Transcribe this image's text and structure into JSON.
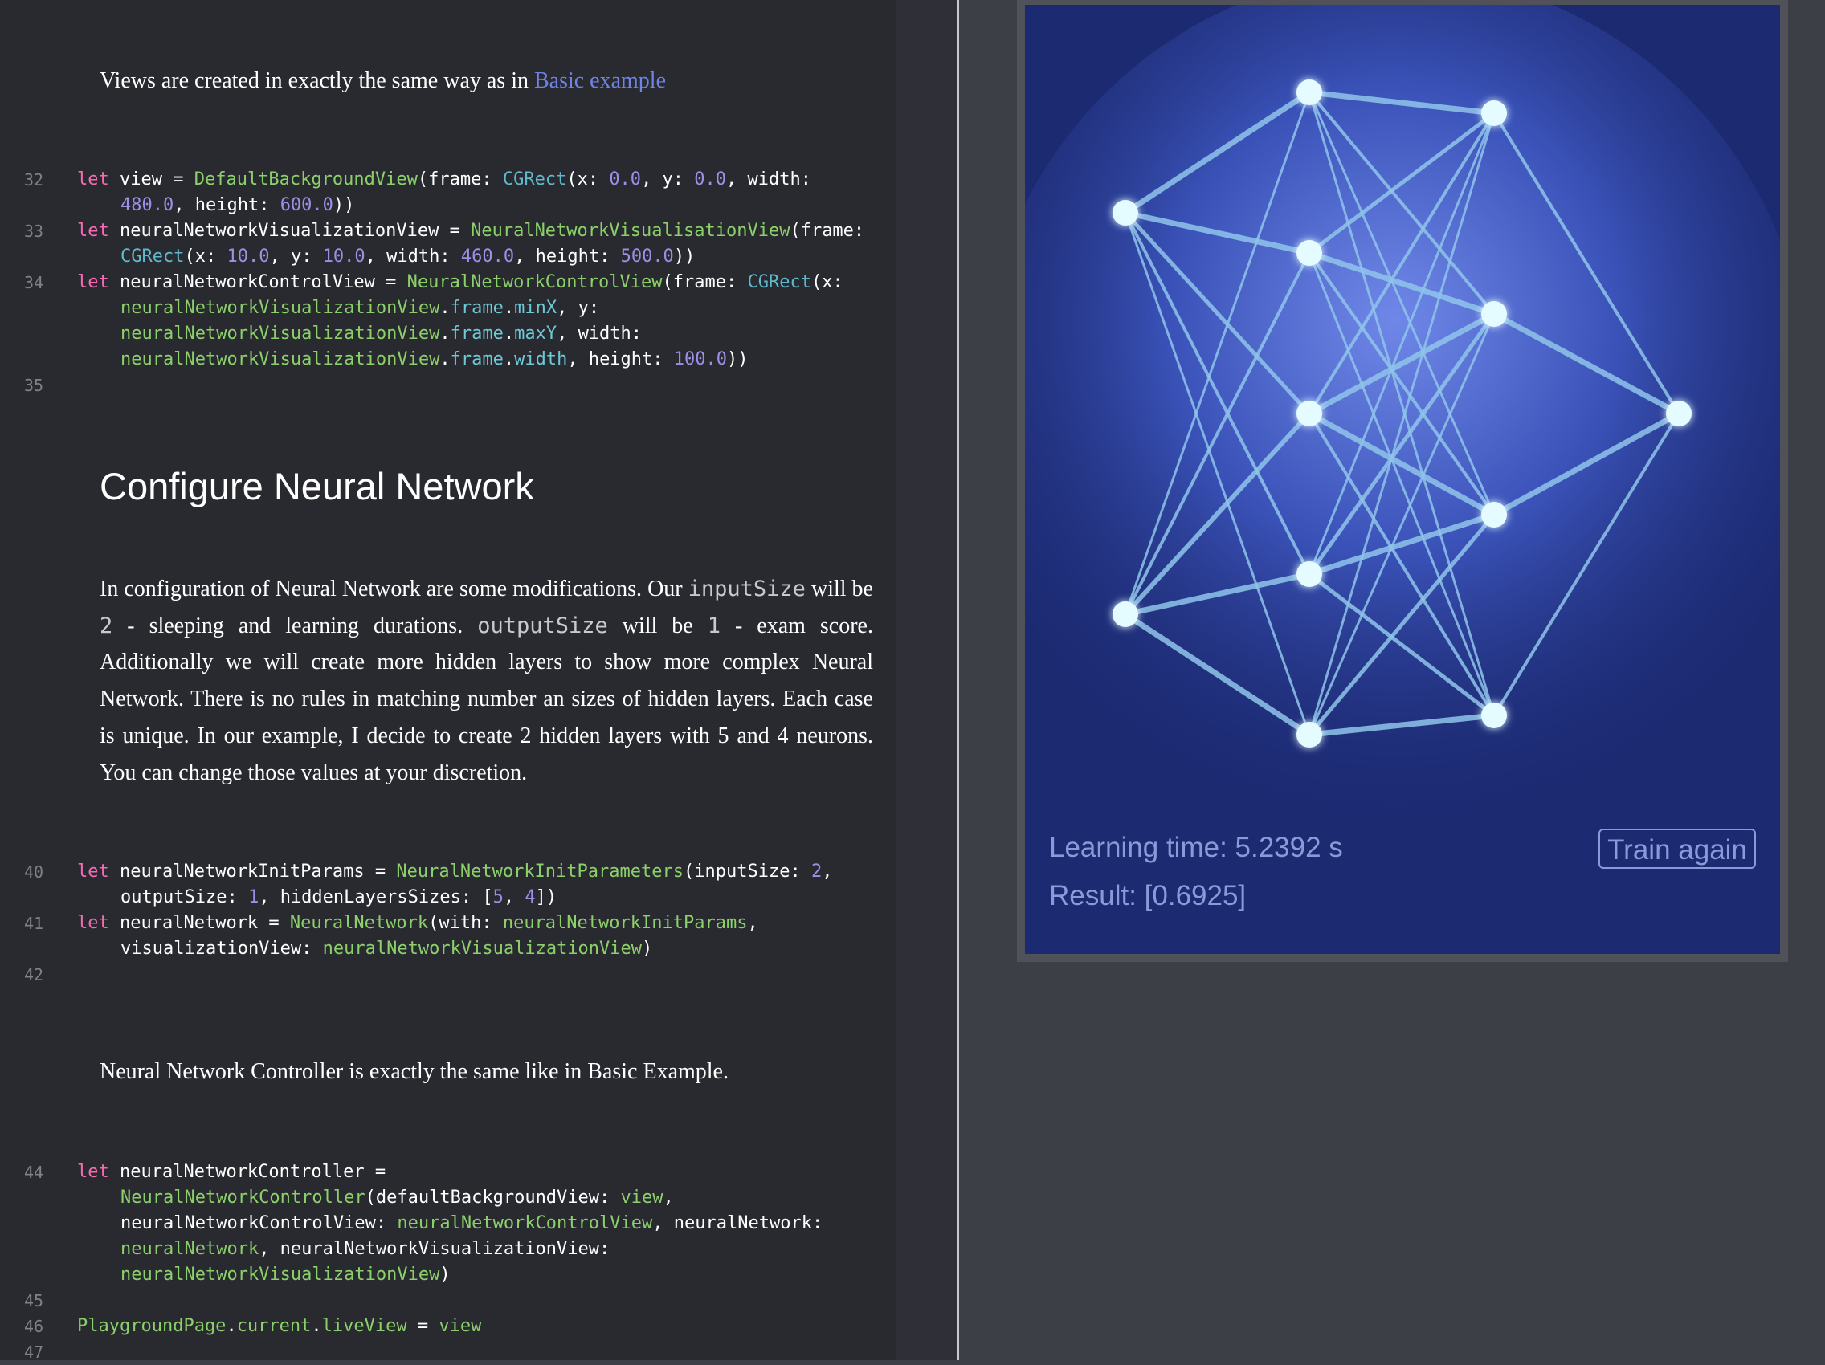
{
  "doc": {
    "intro": {
      "before": "Views are created in exactly the same way as in ",
      "link": "Basic example"
    },
    "heading": "Configure Neural Network",
    "config": {
      "p1": "In configuration of Neural Network are some modifications. Our ",
      "code1": "inputSize",
      "p2": " will be ",
      "code2": "2",
      "p3": " - sleeping and learning durations. ",
      "code3": "outputSize",
      "p4": " will be ",
      "code4": "1",
      "p5": " - exam score. Additionally we will create more hidden layers to show more complex Neural Network. There is no rules in matching number an sizes of hidden layers. Each case is unique. In our example, I decide to create 2 hidden layers with 5 and 4 neurons. You can change those values at your discretion."
    },
    "controller_note": "Neural Network Controller is exactly the same like in Basic Example."
  },
  "code": {
    "l32": {
      "n": "32",
      "kw": "let",
      "a": " view = ",
      "t1": "DefaultBackgroundView",
      "b": "(frame: ",
      "t2": "CGRect",
      "c": "(x: ",
      "n1": "0.0",
      "d": ", y: ",
      "n2": "0.0",
      "e": ", width:",
      "n3": "480.0",
      "f": ", height: ",
      "n4": "600.0",
      "g": "))"
    },
    "l33": {
      "n": "33",
      "kw": "let",
      "a": " neuralNetworkVisualizationView = ",
      "t1": "NeuralNetworkVisualisationView",
      "b": "(frame:",
      "t2": "CGRect",
      "c": "(x: ",
      "n1": "10.0",
      "d": ", y: ",
      "n2": "10.0",
      "e": ", width: ",
      "n3": "460.0",
      "f": ", height: ",
      "n4": "500.0",
      "g": "))"
    },
    "l34": {
      "n": "34",
      "kw": "let",
      "a": " neuralNetworkControlView = ",
      "t1": "NeuralNetworkControlView",
      "b": "(frame: ",
      "t2": "CGRect",
      "c": "(x:",
      "v1": "neuralNetworkVisualizationView",
      "dot1": ".",
      "p1": "frame",
      "dot2": ".",
      "p2": "minX",
      "d": ", y:",
      "v2": "neuralNetworkVisualizationView",
      "p3": "frame",
      "p4": "maxY",
      "e": ", width:",
      "v3": "neuralNetworkVisualizationView",
      "p5": "frame",
      "p6": "width",
      "f": ", height: ",
      "n1": "100.0",
      "g": "))"
    },
    "l35": {
      "n": "35"
    },
    "l40": {
      "n": "40",
      "kw": "let",
      "a": " neuralNetworkInitParams = ",
      "t1": "NeuralNetworkInitParameters",
      "b": "(inputSize: ",
      "n1": "2",
      "c": ",",
      "d": "outputSize: ",
      "n2": "1",
      "e": ", hiddenLayersSizes: [",
      "n3": "5",
      "f": ", ",
      "n4": "4",
      "g": "])"
    },
    "l41": {
      "n": "41",
      "kw": "let",
      "a": " neuralNetwork = ",
      "t1": "NeuralNetwork",
      "b": "(with: ",
      "v1": "neuralNetworkInitParams",
      "c": ",",
      "d": "visualizationView: ",
      "v2": "neuralNetworkVisualizationView",
      "e": ")"
    },
    "l42": {
      "n": "42"
    },
    "l44": {
      "n": "44",
      "kw": "let",
      "a": " neuralNetworkController =",
      "t1": "NeuralNetworkController",
      "b": "(defaultBackgroundView: ",
      "v1": "view",
      "c": ",",
      "d": "neuralNetworkControlView: ",
      "v2": "neuralNetworkControlView",
      "e": ", neuralNetwork:",
      "v3": "neuralNetwork",
      "f": ", neuralNetworkVisualizationView:",
      "v4": "neuralNetworkVisualizationView",
      "g": ")"
    },
    "l45": {
      "n": "45"
    },
    "l46": {
      "n": "46",
      "t1": "PlaygroundPage",
      "dot1": ".",
      "p1": "current",
      "dot2": ".",
      "p2": "liveView",
      "a": " = ",
      "v1": "view"
    },
    "l47": {
      "n": "47"
    }
  },
  "live": {
    "learning_time": "Learning time: 5.2392 s",
    "result": "Result: [0.6925]",
    "button": "Train again",
    "colors": {
      "background": "#1c2a72",
      "glow": "#6f88e8",
      "edge": "#8fc4ea",
      "node": "#e4fbff"
    }
  }
}
